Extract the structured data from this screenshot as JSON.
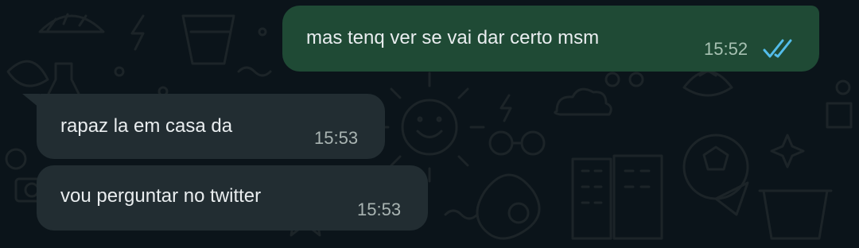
{
  "chat": {
    "messages": [
      {
        "direction": "outgoing",
        "text": "mas tenq ver se vai dar certo msm",
        "time": "15:52",
        "status_icon": "double-check-read-icon"
      },
      {
        "direction": "incoming",
        "text": "rapaz la em casa da",
        "time": "15:53"
      },
      {
        "direction": "incoming",
        "text": "vou perguntar no twitter",
        "time": "15:53"
      }
    ]
  },
  "colors": {
    "background": "#0b141a",
    "outgoing_bubble": "#1f4a35",
    "incoming_bubble": "#222d32",
    "message_text": "#e9edef",
    "read_ticks": "#53bdeb"
  }
}
